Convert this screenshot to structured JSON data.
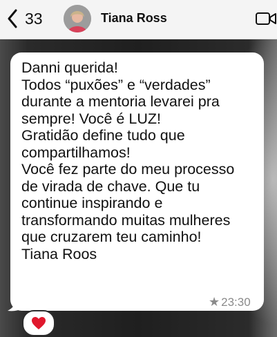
{
  "header": {
    "back_count": "33",
    "contact_name": "Tiana Ross",
    "icons": {
      "back": "chevron-left-icon",
      "video": "video-camera-icon"
    }
  },
  "message": {
    "lines": [
      "Danni querida!",
      "Todos “puxões” e “verdades”",
      "durante a mentoria levarei pra",
      "sempre! Você é LUZ!",
      "Gratidão define tudo que",
      "compartilhamos!",
      "Você fez parte do meu processo",
      "de virada de chave. Que tu",
      "continue inspirando e",
      "transformando muitas mulheres",
      "que cruzarem teu caminho!",
      "Tiana Roos"
    ],
    "starred_icon": "star-icon",
    "time": "23:30",
    "reaction": "heart-icon",
    "colors": {
      "bubble": "#ffffff",
      "heart": "#e0182d"
    }
  }
}
